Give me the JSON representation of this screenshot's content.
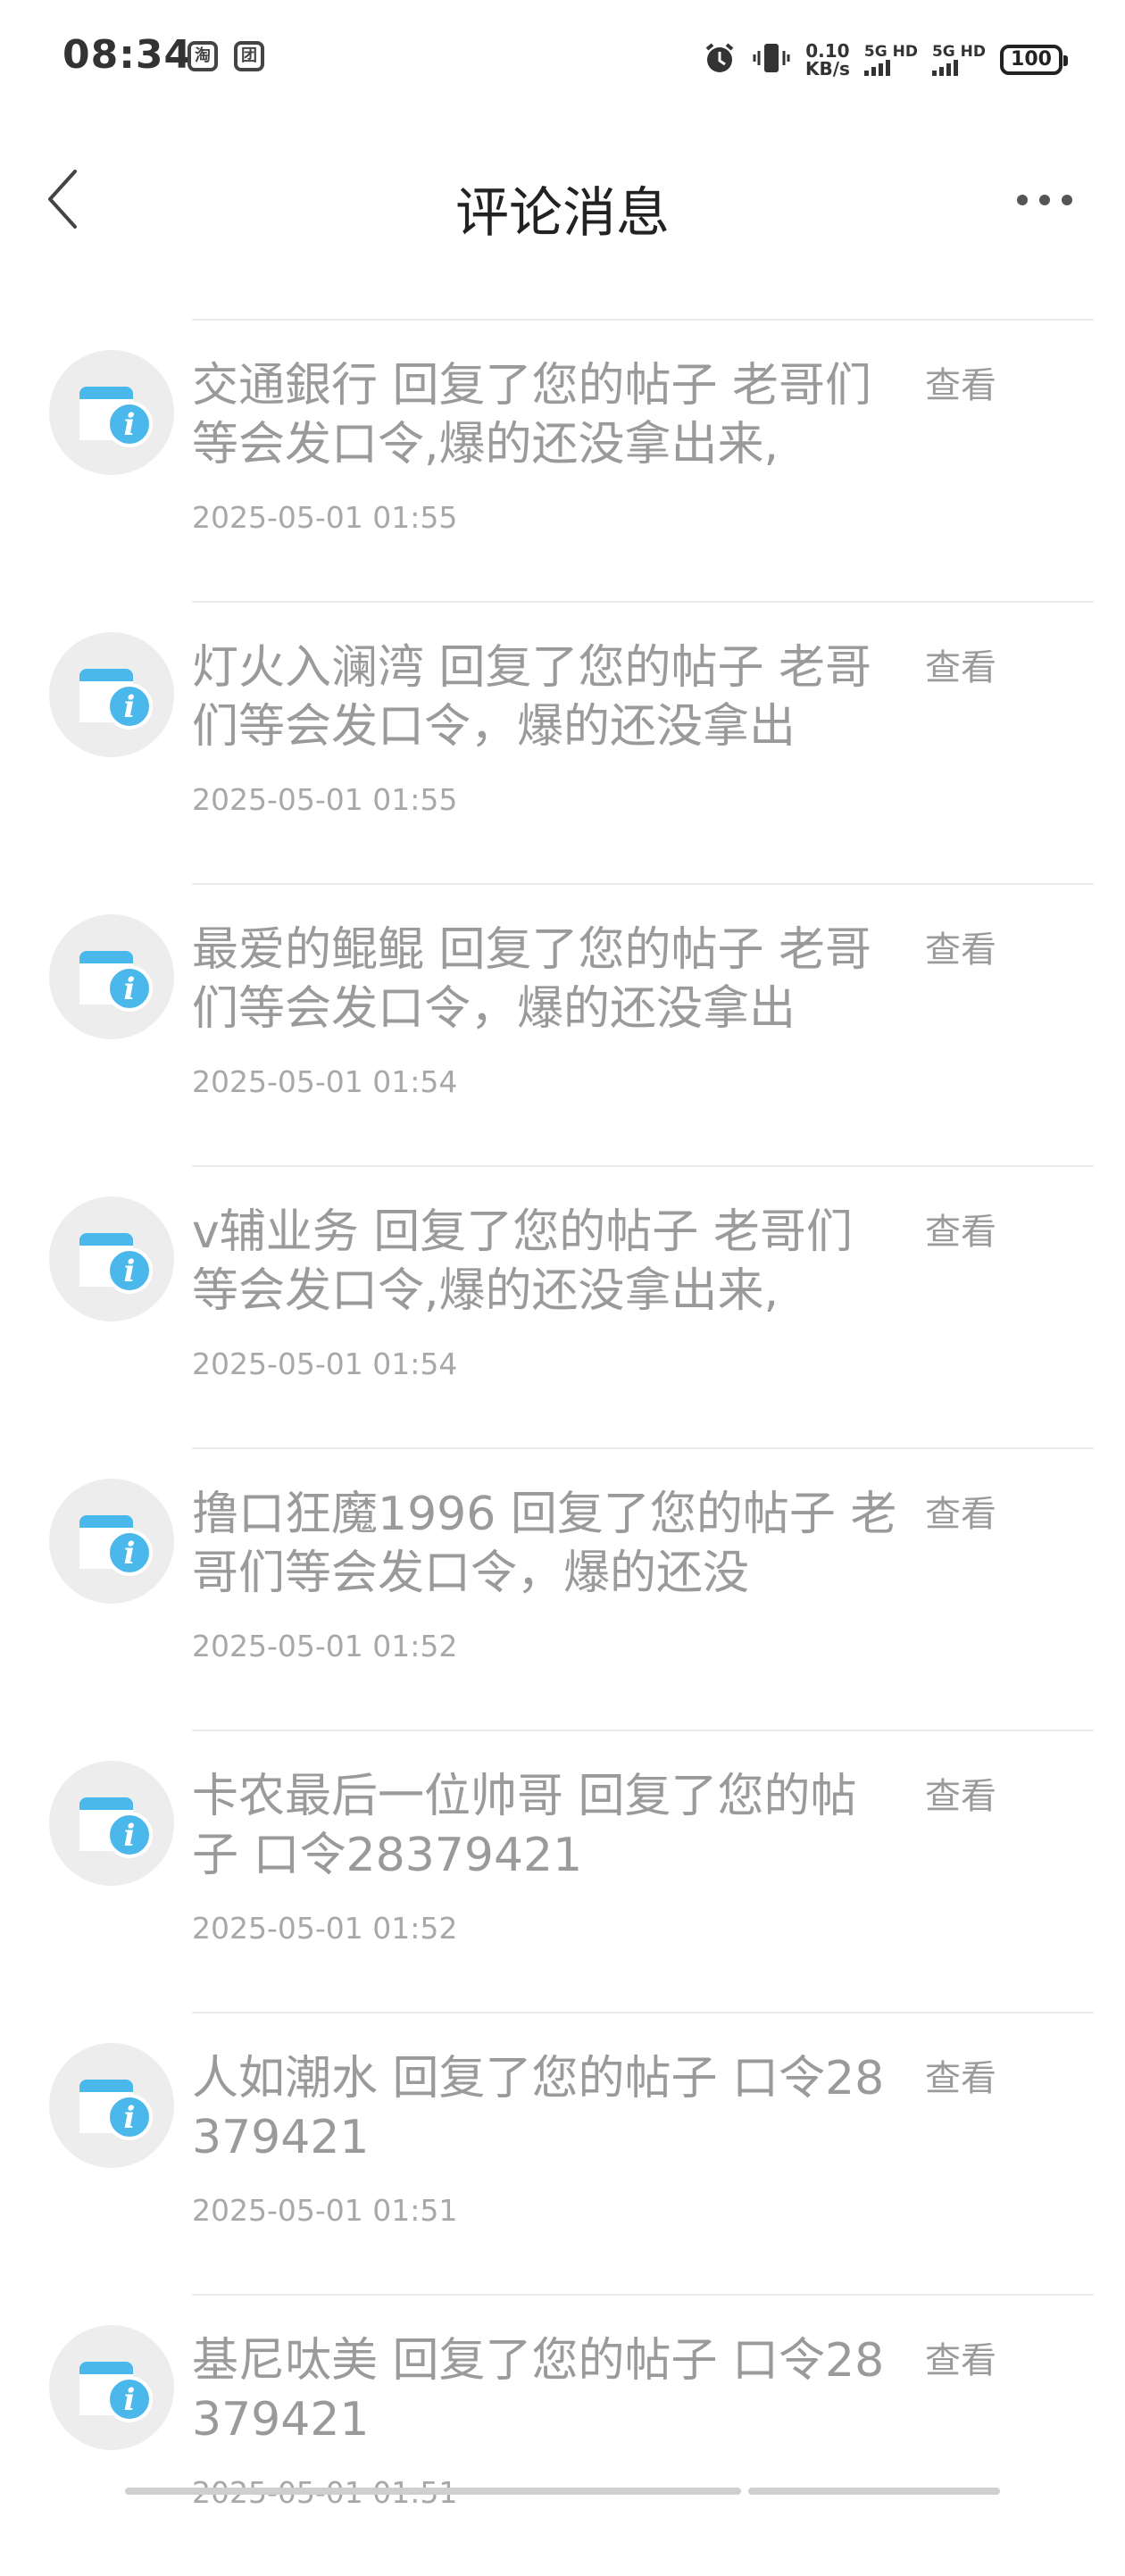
{
  "status_bar": {
    "time": "08:34",
    "app_icons": [
      "淘",
      "团"
    ],
    "net_speed_value": "0.10",
    "net_speed_unit": "KB/s",
    "sim1": "5G HD",
    "sim2": "5G HD",
    "battery": "100"
  },
  "header": {
    "title": "评论消息",
    "back_icon": "chevron-left-icon",
    "more_icon": "more-horizontal-icon"
  },
  "colors": {
    "accent": "#4bb8ec",
    "text_gray": "#9a9a9a",
    "avatar_bg": "#ededed"
  },
  "messages": [
    {
      "content": "交通銀行 回复了您的帖子 老哥们等会发口令,爆的还没拿出来,",
      "time": "2025-05-01 01:55",
      "action": "查看"
    },
    {
      "content": "灯火入澜湾 回复了您的帖子 老哥们等会发口令，爆的还没拿出",
      "time": "2025-05-01 01:55",
      "action": "查看"
    },
    {
      "content": "最爱的鲲鲲 回复了您的帖子 老哥们等会发口令，爆的还没拿出",
      "time": "2025-05-01 01:54",
      "action": "查看"
    },
    {
      "content": "v辅业务 回复了您的帖子 老哥们等会发口令,爆的还没拿出来,",
      "time": "2025-05-01 01:54",
      "action": "查看"
    },
    {
      "content": "撸口狂魔1996 回复了您的帖子 老哥们等会发口令，爆的还没",
      "time": "2025-05-01 01:52",
      "action": "查看"
    },
    {
      "content": "卡农最后一位帅哥 回复了您的帖子 口令28379421",
      "time": "2025-05-01 01:52",
      "action": "查看"
    },
    {
      "content": "人如潮水 回复了您的帖子 口令28379421",
      "time": "2025-05-01 01:51",
      "action": "查看"
    },
    {
      "content": "基尼呔美 回复了您的帖子 口令28379421",
      "time": "2025-05-01 01:51",
      "action": "查看"
    }
  ]
}
